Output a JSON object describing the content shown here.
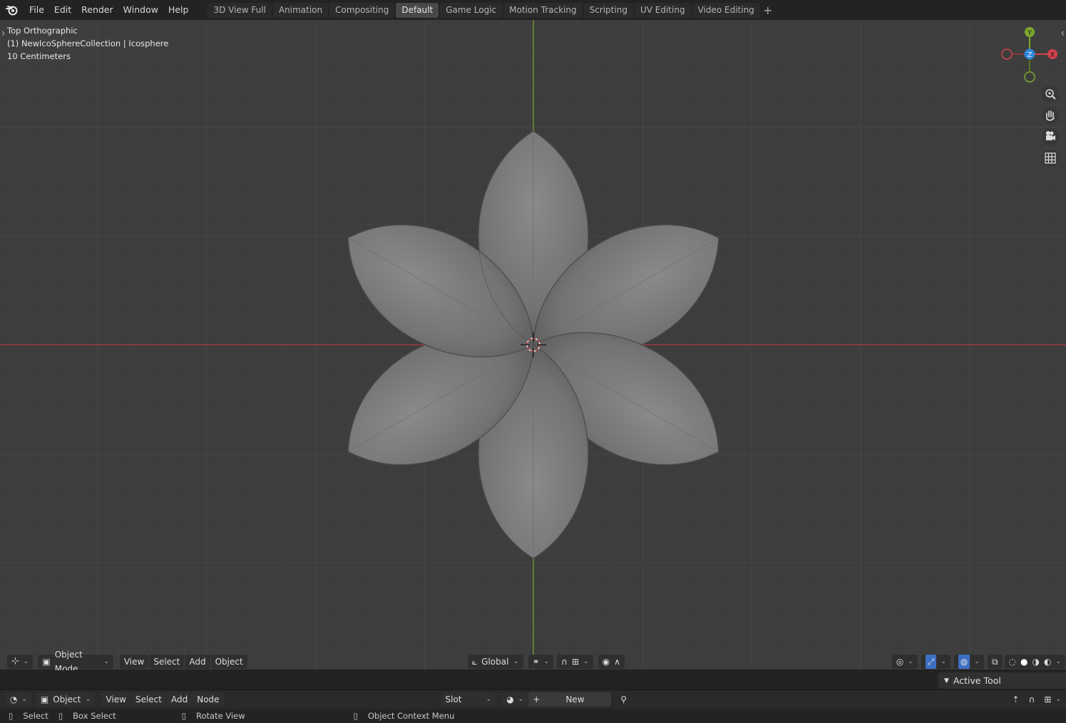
{
  "menu": {
    "file": "File",
    "edit": "Edit",
    "render": "Render",
    "window": "Window",
    "help": "Help"
  },
  "workspaces": [
    {
      "label": "3D View Full"
    },
    {
      "label": "Animation"
    },
    {
      "label": "Compositing"
    },
    {
      "label": "Default",
      "active": true
    },
    {
      "label": "Game Logic"
    },
    {
      "label": "Motion Tracking"
    },
    {
      "label": "Scripting"
    },
    {
      "label": "UV Editing"
    },
    {
      "label": "Video Editing"
    }
  ],
  "viewport": {
    "view_name": "Top Orthographic",
    "object_info": "(1) NewIcoSphereCollection | Icosphere",
    "scale": "10 Centimeters",
    "gizmo": {
      "x": "X",
      "y": "Y",
      "z": "Z"
    },
    "colors": {
      "bg": "#3d3d3d",
      "x_axis": "#d4424f",
      "y_axis": "#7ea72c",
      "z_axis": "#2f86d8"
    }
  },
  "viewport_header": {
    "mode": "Object Mode",
    "view": "View",
    "select": "Select",
    "add": "Add",
    "object": "Object",
    "transform": "Global"
  },
  "node_header": {
    "type": "Object",
    "view": "View",
    "select": "Select",
    "add": "Add",
    "node": "Node",
    "slot": "Slot",
    "new": "New"
  },
  "sidebar": {
    "active_tool": "Active Tool"
  },
  "status_bar": {
    "select": "Select",
    "box_select": "Box Select",
    "rotate_view": "Rotate View",
    "context_menu": "Object Context Menu"
  }
}
